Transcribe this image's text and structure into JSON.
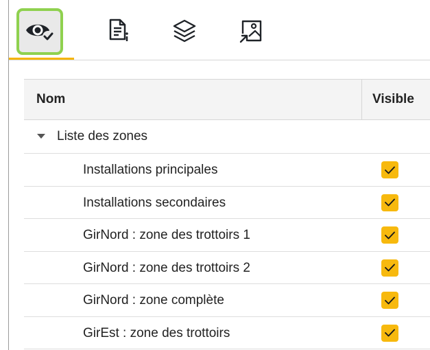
{
  "toolbar": {
    "tools": [
      {
        "icon": "eye-check-icon",
        "active": true
      },
      {
        "icon": "document-info-icon",
        "active": false
      },
      {
        "icon": "layers-icon",
        "active": false
      },
      {
        "icon": "image-export-icon",
        "active": false
      }
    ],
    "active_tab_color": "#f5b400",
    "active_border_color": "#8fd14f"
  },
  "table": {
    "columns": {
      "name": "Nom",
      "visible": "Visible"
    },
    "group": {
      "label": "Liste des zones",
      "expanded": true
    },
    "rows": [
      {
        "label": "Installations principales",
        "visible": true
      },
      {
        "label": "Installations secondaires",
        "visible": true
      },
      {
        "label": "GirNord : zone des trottoirs 1",
        "visible": true
      },
      {
        "label": "GirNord : zone des trottoirs 2",
        "visible": true
      },
      {
        "label": "GirNord : zone complète",
        "visible": true
      },
      {
        "label": "GirEst : zone des trottoirs",
        "visible": true
      }
    ],
    "checkbox_color": "#f7b90e"
  }
}
